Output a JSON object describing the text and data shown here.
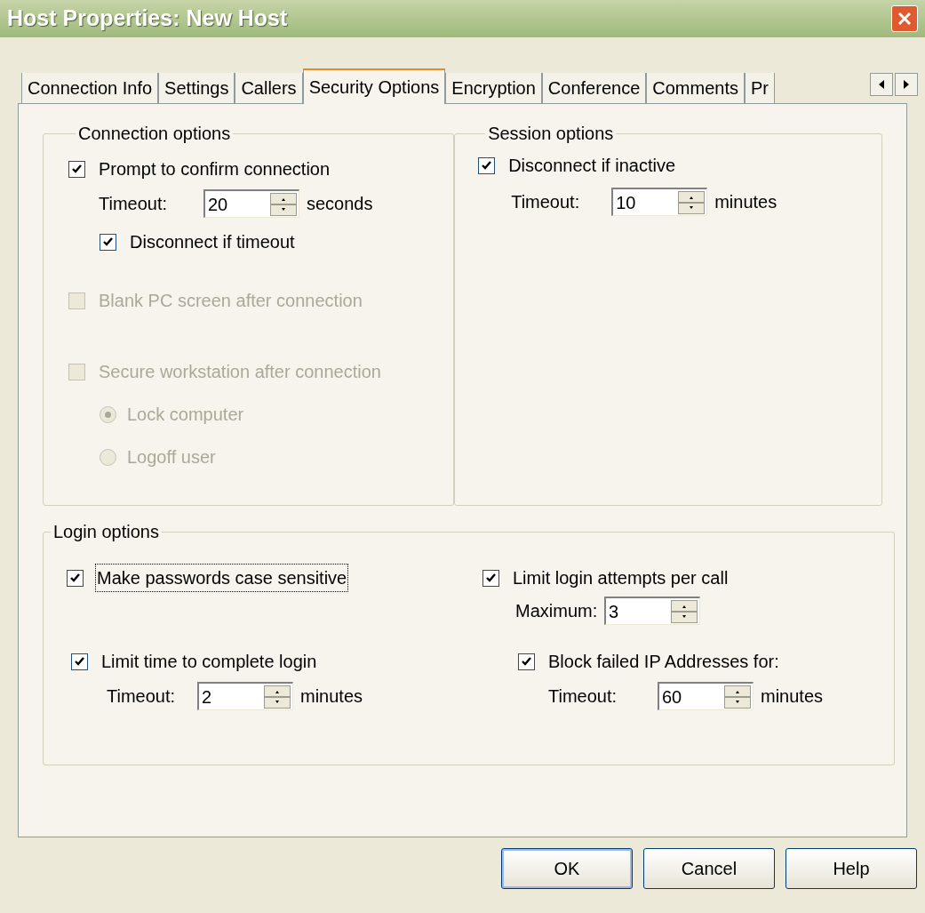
{
  "window": {
    "title": "Host Properties: New Host"
  },
  "tabs": [
    {
      "label": "Connection Info",
      "selected": false
    },
    {
      "label": "Settings",
      "selected": false
    },
    {
      "label": "Callers",
      "selected": false
    },
    {
      "label": "Security Options",
      "selected": true
    },
    {
      "label": "Encryption",
      "selected": false
    },
    {
      "label": "Conference",
      "selected": false
    },
    {
      "label": "Comments",
      "selected": false
    },
    {
      "label": "Pr",
      "selected": false
    }
  ],
  "connection_options": {
    "title": "Connection options",
    "prompt": {
      "label": "Prompt to confirm connection",
      "checked": true,
      "disabled": false
    },
    "timeout": {
      "label": "Timeout:",
      "value": "20",
      "unit": "seconds"
    },
    "disconnect_if_timeout": {
      "label": "Disconnect if timeout",
      "checked": true,
      "disabled": false
    },
    "blank_screen": {
      "label": "Blank PC screen after connection",
      "checked": false,
      "disabled": true
    },
    "secure_workstation": {
      "label": "Secure workstation after connection",
      "checked": false,
      "disabled": true
    },
    "lock_options": [
      {
        "label": "Lock computer",
        "selected": true,
        "disabled": true
      },
      {
        "label": "Logoff user",
        "selected": false,
        "disabled": true
      }
    ]
  },
  "session_options": {
    "title": "Session options",
    "disconnect_if_inactive": {
      "label": "Disconnect if inactive",
      "checked": true,
      "disabled": false
    },
    "timeout": {
      "label": "Timeout:",
      "value": "10",
      "unit": "minutes"
    }
  },
  "login_options": {
    "title": "Login options",
    "case_sensitive": {
      "label": "Make passwords case sensitive",
      "checked": true,
      "disabled": false,
      "focused": true
    },
    "limit_attempts": {
      "label": "Limit login attempts per call",
      "checked": true,
      "disabled": false
    },
    "maximum": {
      "label": "Maximum:",
      "value": "3"
    },
    "limit_time": {
      "label": "Limit time to complete login",
      "checked": true,
      "disabled": false
    },
    "login_timeout": {
      "label": "Timeout:",
      "value": "2",
      "unit": "minutes"
    },
    "block_failed_ip": {
      "label": "Block failed IP Addresses for:",
      "checked": true,
      "disabled": false
    },
    "block_timeout": {
      "label": "Timeout:",
      "value": "60",
      "unit": "minutes"
    }
  },
  "buttons": [
    {
      "label": "OK",
      "default": true
    },
    {
      "label": "Cancel",
      "default": false
    },
    {
      "label": "Help",
      "default": false
    }
  ]
}
